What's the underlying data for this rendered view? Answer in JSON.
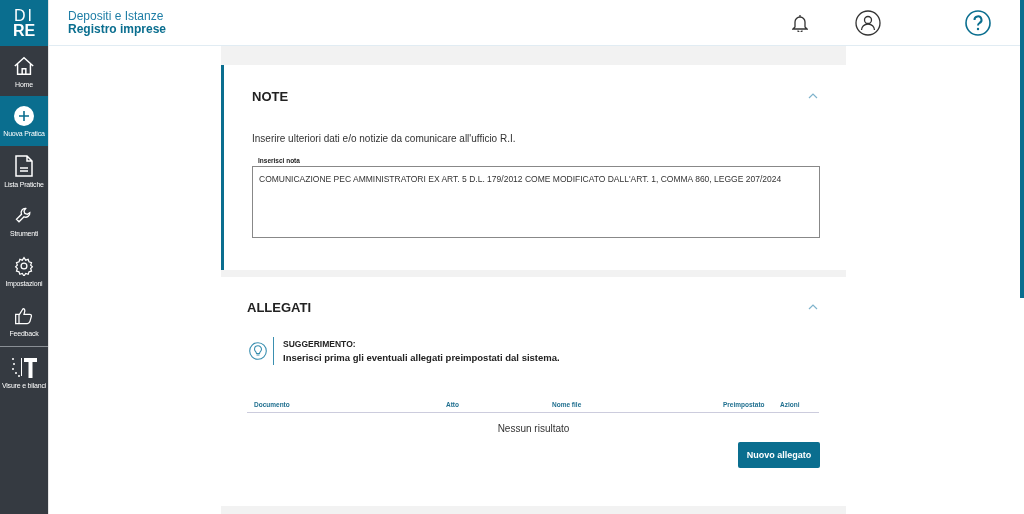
{
  "logo": {
    "line1": "DI",
    "line2": "RE"
  },
  "header": {
    "subtitle": "Depositi e Istanze",
    "title": "Registro imprese"
  },
  "sidebar": {
    "items": [
      {
        "kind": "home",
        "label": "Home",
        "selected": false
      },
      {
        "kind": "plus",
        "label": "Nuova Pratica",
        "selected": true
      },
      {
        "kind": "document",
        "label": "Lista Pratiche",
        "selected": false
      },
      {
        "kind": "wrench",
        "label": "Strumenti",
        "selected": false
      },
      {
        "kind": "gear",
        "label": "Impostazioni",
        "selected": false
      },
      {
        "kind": "thumb",
        "label": "Feedback",
        "selected": false
      },
      {
        "kind": "visure",
        "label": "Visure e bilanci",
        "selected": false
      }
    ]
  },
  "note_section": {
    "title": "NOTE",
    "expanded": true,
    "description": "Inserire ulteriori dati e/o notizie da comunicare all'ufficio R.I.",
    "field_label": "Inserisci nota",
    "field_value": "COMUNICAZIONE PEC AMMINISTRATORI EX ART. 5 D.L. 179/2012 COME MODIFICATO DALL'ART. 1, COMMA 860, LEGGE 207/2024"
  },
  "attachments_section": {
    "title": "ALLEGATI",
    "expanded": true,
    "tip_title": "SUGGERIMENTO:",
    "tip_text": "Inserisci prima gli eventuali allegati preimpostati dal sistema.",
    "table": {
      "columns": [
        "Documento",
        "Atto",
        "Nome file",
        "Preimpostato",
        "Azioni"
      ],
      "empty_text": "Nessun risultato"
    },
    "button": "Nuovo allegato"
  }
}
